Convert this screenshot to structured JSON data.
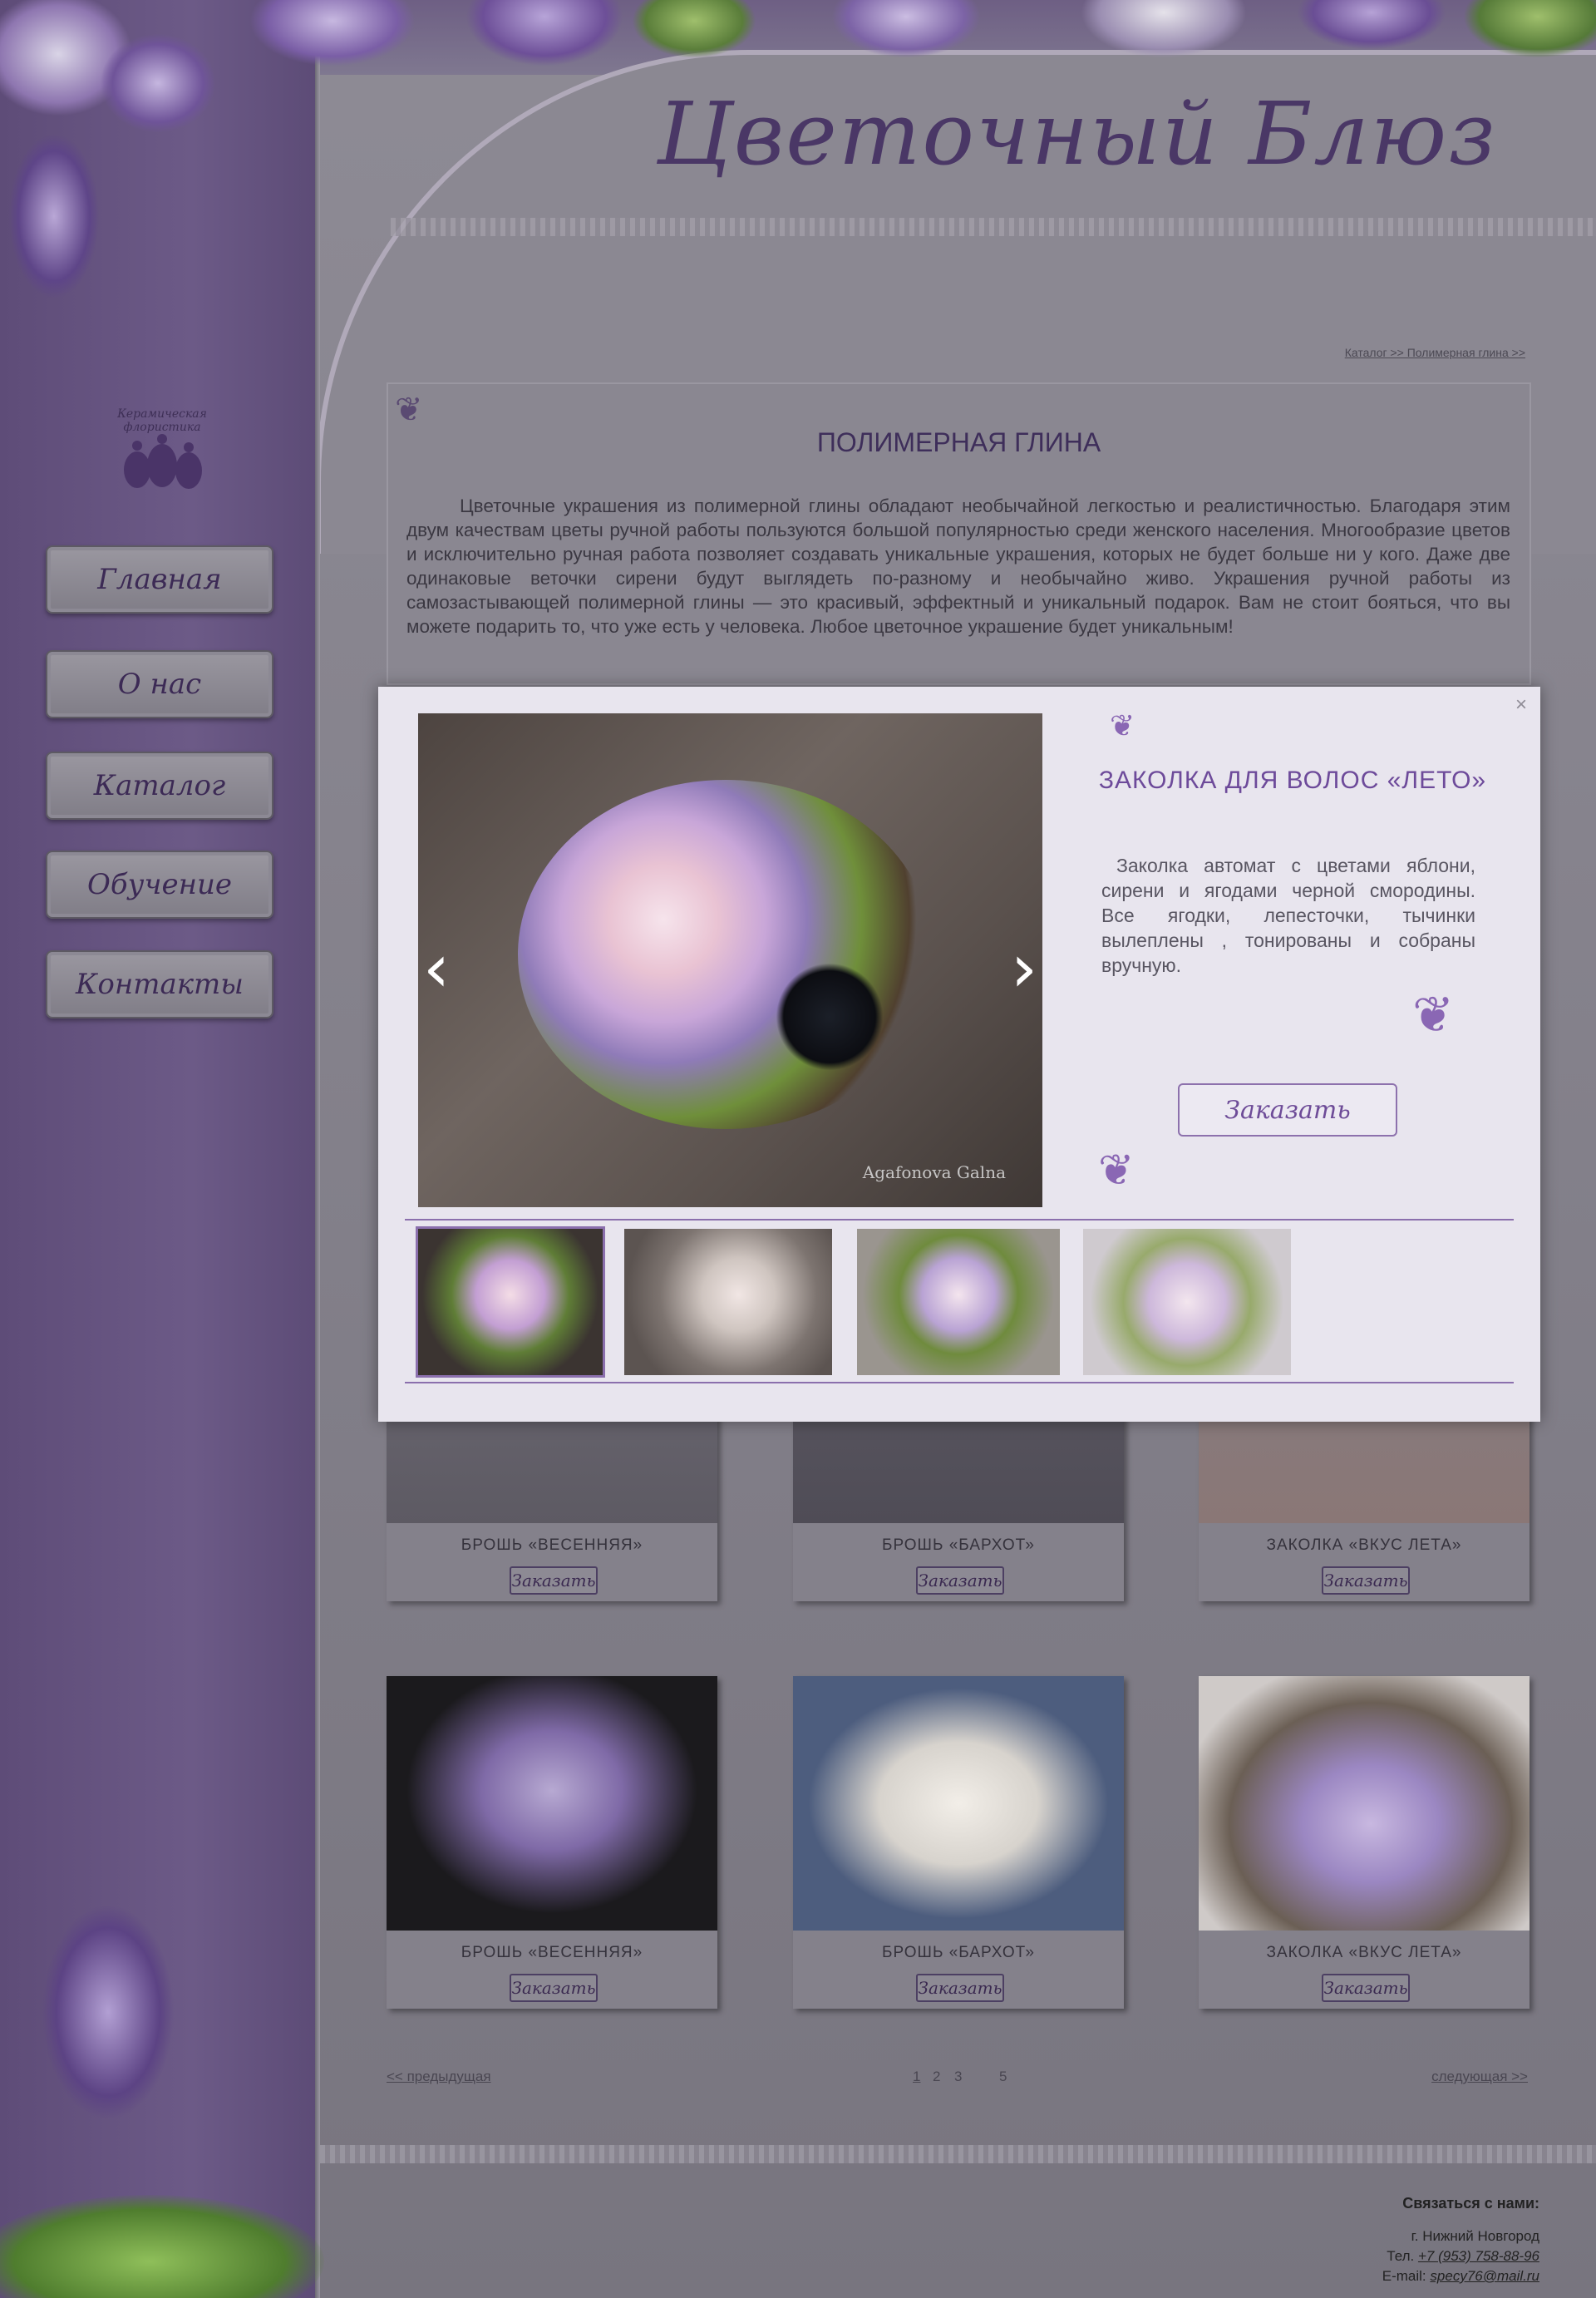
{
  "site": {
    "logo_title": "Цветочный Блюз",
    "emblem_text": "Керамическая флористика"
  },
  "nav": {
    "items": [
      "Главная",
      "О нас",
      "Каталог",
      "Обучение",
      "Контакты"
    ]
  },
  "breadcrumb": "Каталог >> Полимерная глина >>",
  "main": {
    "title": "ПОЛИМЕРНАЯ ГЛИНА",
    "text": "Цветочные украшения из полимерной глины обладают необычайной легкостью и реалистичностью. Благодаря этим двум качествам цветы ручной работы пользуются большой популярностью среди женского населения. Многообразие цветов и исключительно ручная работа позволяет создавать уникальные украшения, которых не будет больше ни у кого. Даже две одинаковые веточки сирени будут выглядеть по-разному и необычайно живо. Украшения ручной работы из самозастывающей полимерной глины — это красивый, эффектный и уникальный подарок. Вам не стоит бояться, что вы можете подарить то, что уже есть у человека. Любое цветочное украшение будет уникальным!"
  },
  "products": [
    {
      "name": "БРОШЬ «ВЕСЕННЯЯ»",
      "order": "Заказать"
    },
    {
      "name": "БРОШЬ «БАРХОТ»",
      "order": "Заказать"
    },
    {
      "name": "ЗАКОЛКА «ВКУС ЛЕТА»",
      "order": "Заказать"
    },
    {
      "name": "БРОШЬ «ВЕСЕННЯЯ»",
      "order": "Заказать"
    },
    {
      "name": "БРОШЬ «БАРХОТ»",
      "order": "Заказать"
    },
    {
      "name": "ЗАКОЛКА «ВКУС ЛЕТА»",
      "order": "Заказать"
    }
  ],
  "pagination": {
    "prev": "<< предыдущая",
    "pages": [
      "1",
      "2",
      "3",
      "5"
    ],
    "next": "следующая >>"
  },
  "footer": {
    "heading": "Связаться с нами:",
    "city": "г. Нижний Новгород",
    "phone_label": "Тел.",
    "phone": "+7 (953) 758-88-96",
    "email_label": "E-mail:",
    "email": "specy76@mail.ru"
  },
  "modal": {
    "close": "×",
    "title": "ЗАКОЛКА ДЛЯ ВОЛОС «ЛЕТО»",
    "description": "Заколка автомат с цветами яблони, сирени и ягодами черной смородины. Все ягодки, лепесточки, тычинки вылеплены , тонированы и собраны вручную.",
    "order": "Заказать",
    "watermark": "Agafonova Galna",
    "prev_arrow": "‹",
    "next_arrow": "›"
  }
}
